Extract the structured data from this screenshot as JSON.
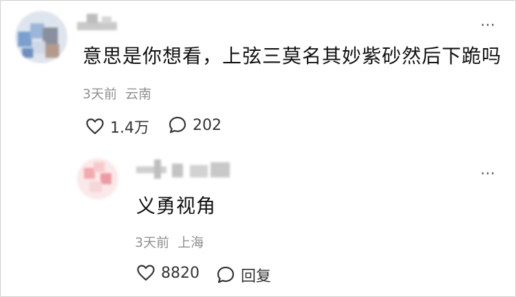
{
  "comment": {
    "text": "意思是你想看，上弦三莫名其妙紫砂然后下跪吗",
    "time": "3天前",
    "location": "云南",
    "likes": "1.4万",
    "replies_count": "202"
  },
  "reply": {
    "text": "义勇视角",
    "time": "3天前",
    "location": "上海",
    "likes": "8820",
    "reply_label": "回复"
  },
  "icons": {
    "like": "heart-outline-icon",
    "comment": "speech-bubble-icon",
    "more": "more-dots-icon"
  },
  "colors": {
    "text": "#111111",
    "meta": "#8f8f8f",
    "icon": "#333333"
  }
}
